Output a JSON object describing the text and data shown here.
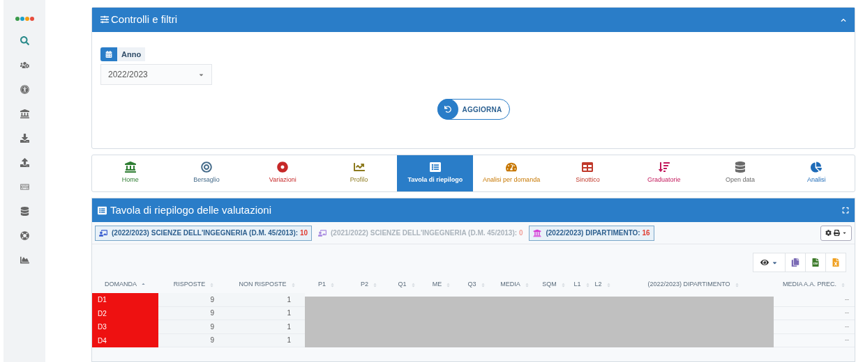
{
  "sidebar": {
    "items": [
      {
        "kind": "logo"
      },
      {
        "kind": "search"
      },
      {
        "kind": "users"
      },
      {
        "kind": "accessibility"
      },
      {
        "kind": "landmark"
      },
      {
        "kind": "download"
      },
      {
        "kind": "upload"
      },
      {
        "kind": "keyboard"
      },
      {
        "kind": "database"
      },
      {
        "kind": "lifering"
      },
      {
        "kind": "chart"
      }
    ]
  },
  "filters": {
    "title": "Controlli e filtri",
    "year_label": "Anno",
    "year_value": "2022/2023",
    "refresh_button": "AGGIORNA"
  },
  "nav": [
    {
      "label": "Home",
      "kind": "landmark",
      "color": "#2e7d32",
      "selected": false
    },
    {
      "label": "Bersaglio",
      "kind": "target",
      "color": "#456b8a",
      "selected": false
    },
    {
      "label": "Variazioni",
      "kind": "dot",
      "color": "#c62828",
      "selected": false
    },
    {
      "label": "Profilo",
      "kind": "chart",
      "color": "#8d7a1e",
      "selected": false
    },
    {
      "label": "Tavola di riepilogo",
      "kind": "table",
      "color": "#2a7dc8",
      "selected": true
    },
    {
      "label": "Analisi per domanda",
      "kind": "gauge",
      "color": "#c77700",
      "selected": false
    },
    {
      "label": "Sinottico",
      "kind": "grid",
      "color": "#c0392b",
      "selected": false
    },
    {
      "label": "Graduatorie",
      "kind": "sort",
      "color": "#c2185b",
      "selected": false
    },
    {
      "label": "Open data",
      "kind": "database",
      "color": "#6b6b6b",
      "selected": false
    },
    {
      "label": "Analisi",
      "kind": "pie",
      "color": "#1e6bb8",
      "selected": false
    }
  ],
  "summary": {
    "title": "Tavola di riepilogo delle valutazioni",
    "badges": [
      {
        "label": "(2022/2023) SCIENZE DELL'INGEGNERIA (D.M. 45/2013):",
        "count": "10",
        "kind": "course",
        "selected": true
      },
      {
        "label": "(2021/2022) SCIENZE DELL'INGEGNERIA (D.M. 45/2013):",
        "count": "0",
        "kind": "course",
        "selected": false
      },
      {
        "label": "(2022/2023) DIPARTIMENTO:",
        "count": "16",
        "kind": "department",
        "selected": true
      }
    ],
    "table": {
      "columns": [
        {
          "label": "DOMANDA",
          "sorted": true
        },
        {
          "label": "RISPOSTE",
          "sorted": false
        },
        {
          "label": "NON RISPOSTE",
          "sorted": false
        },
        {
          "label": "P1",
          "sorted": false
        },
        {
          "label": "P2",
          "sorted": false
        },
        {
          "label": "Q1",
          "sorted": false
        },
        {
          "label": "ME",
          "sorted": false
        },
        {
          "label": "Q3",
          "sorted": false
        },
        {
          "label": "MEDIA",
          "sorted": false
        },
        {
          "label": "SQM",
          "sorted": false
        },
        {
          "label": "L1",
          "sorted": false
        },
        {
          "label": "L2",
          "sorted": false
        },
        {
          "label": "(2022/2023) DIPARTIMENTO",
          "sorted": false
        },
        {
          "label": "MEDIA A.A. PREC.",
          "sorted": false
        }
      ],
      "rows": [
        {
          "domanda": "D1",
          "risposte": "9",
          "non_risposte": "1",
          "media_prec": "--"
        },
        {
          "domanda": "D2",
          "risposte": "9",
          "non_risposte": "1",
          "media_prec": "--"
        },
        {
          "domanda": "D3",
          "risposte": "9",
          "non_risposte": "1",
          "media_prec": "--"
        },
        {
          "domanda": "D4",
          "risposte": "9",
          "non_risposte": "1",
          "media_prec": "--"
        }
      ]
    }
  }
}
